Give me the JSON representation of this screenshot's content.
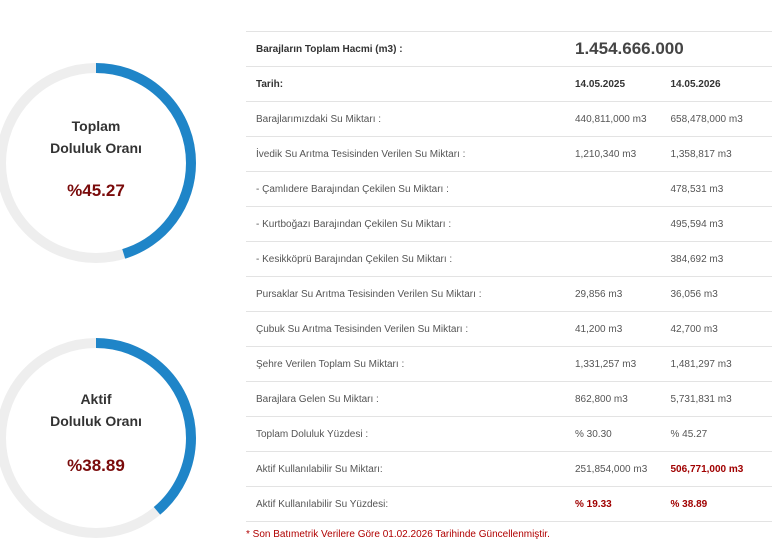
{
  "gauges": [
    {
      "title_line1": "Toplam",
      "title_line2": "Doluluk Oranı",
      "value_text": "%45.27",
      "fraction": 0.4527
    },
    {
      "title_line1": "Aktif",
      "title_line2": "Doluluk Oranı",
      "value_text": "%38.89",
      "fraction": 0.3889
    }
  ],
  "colors": {
    "track": "#eeeeee",
    "arc": "#1f85c8",
    "value": "#7a0b0b",
    "highlight": "#a00000"
  },
  "table": {
    "total_label": "Barajların Toplam Hacmi (m3) :",
    "total_value": "1.454.666.000",
    "date_label": "Tarih:",
    "date1": "14.05.2025",
    "date2": "14.05.2026",
    "rows": [
      {
        "label": "Barajlarımızdaki Su Miktarı :",
        "v1": "440,811,000 m3",
        "v2": "658,478,000 m3"
      },
      {
        "label": "İvedik Su Arıtma Tesisinden Verilen Su Miktarı :",
        "v1": "1,210,340 m3",
        "v2": "1,358,817 m3"
      },
      {
        "label": "- Çamlıdere Barajından Çekilen Su Miktarı :",
        "v1": "",
        "v2": "478,531 m3"
      },
      {
        "label": "- Kurtboğazı Barajından Çekilen Su Miktarı :",
        "v1": "",
        "v2": "495,594 m3"
      },
      {
        "label": "- Kesikköprü Barajından Çekilen Su Miktarı :",
        "v1": "",
        "v2": "384,692 m3"
      },
      {
        "label": "Pursaklar Su Arıtma Tesisinden Verilen Su Miktarı :",
        "v1": "29,856 m3",
        "v2": "36,056 m3"
      },
      {
        "label": "Çubuk Su Arıtma Tesisinden Verilen Su Miktarı :",
        "v1": "41,200 m3",
        "v2": "42,700 m3"
      },
      {
        "label": "Şehre Verilen Toplam Su Miktarı :",
        "v1": "1,331,257 m3",
        "v2": "1,481,297 m3"
      },
      {
        "label": "Barajlara Gelen Su Miktarı :",
        "v1": "862,800 m3",
        "v2": "5,731,831 m3"
      },
      {
        "label": "Toplam Doluluk Yüzdesi :",
        "v1": "% 30.30",
        "v2": "% 45.27"
      },
      {
        "label": "Aktif Kullanılabilir Su Miktarı:",
        "v1": "251,854,000 m3",
        "v2": "506,771,000 m3"
      },
      {
        "label": "Aktif Kullanılabilir Su Yüzdesi:",
        "v1": "% 19.33",
        "v2": "% 38.89"
      }
    ]
  },
  "footnote": "* Son Batımetrik Verilere Göre 01.02.2026 Tarihinde Güncellenmiştir."
}
